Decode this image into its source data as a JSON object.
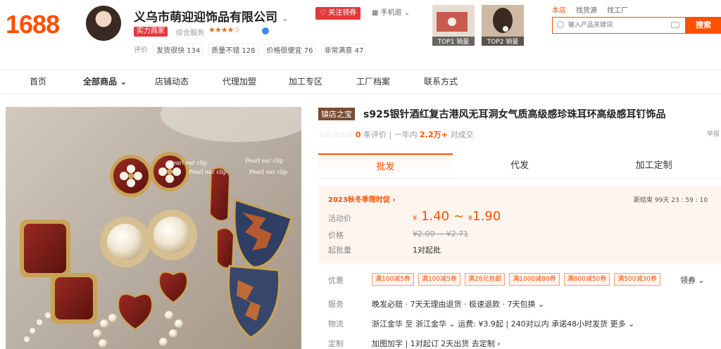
{
  "header": {
    "logo": "1688",
    "shop_name": "义乌市萌迎迎饰品有限公司",
    "badge": "实力商家",
    "service_label": "综合服务",
    "stars": "★★★★☆",
    "ratings_label": "评价",
    "ratings": [
      "发货很快 134",
      "质量不错 128",
      "价格很便宜 76",
      "非常满意 47"
    ],
    "follow_label": "关注领券",
    "mobile_label": "手机逛",
    "top1_label": "TOP1 销量",
    "top2_label": "TOP2 销量"
  },
  "search": {
    "tabs": [
      "本店",
      "找货源",
      "找工厂"
    ],
    "placeholder": "输入产品关键词",
    "button": "搜索"
  },
  "nav": {
    "items": [
      "首页",
      "全部商品",
      "店铺动态",
      "代理加盟",
      "加工专区",
      "工厂档案",
      "联系方式"
    ]
  },
  "gallery": {
    "caption1": "Pearl ear clip",
    "caption2": "Pearl ear clip",
    "caption3": "Pearl ear clip",
    "caption4": "Pearl ear clip"
  },
  "product": {
    "tag": "镇店之宝",
    "title": "s925银针酒红复古港风无耳洞女气质高级感珍珠耳环高级感耳钉饰品",
    "reviews_count": "0",
    "reviews_label": "条评价",
    "sales_period": "一年内",
    "sales_value": "2.2万+",
    "sales_label": "对成交",
    "cut_label": "举报"
  },
  "tabs": [
    "批发",
    "代发",
    "加工定制"
  ],
  "pricing": {
    "promo": "2023秋冬季限时促 ›",
    "countdown_label": "距结束",
    "countdown": "99天 23 : 59 : 10",
    "activity_label": "活动价",
    "activity_low": "1.40",
    "activity_high": "1.90",
    "currency": "¥",
    "tilde": "~",
    "price_label": "价格",
    "orig_price": "¥2.00 ~ ¥2.71",
    "moq_label": "起批量",
    "moq": "1对起批"
  },
  "rows": {
    "coupon_label": "优惠",
    "coupons": [
      "满100减5券",
      "满100减5券",
      "满28元包邮",
      "满1000减80券",
      "满800减50券",
      "满500减30券"
    ],
    "coupon_more": "领券 ⌄",
    "service_label": "服务",
    "service": "晚发必赔 · 7天无理由退货 · 极速退款 · 7天包换 ⌄",
    "logistics_label": "物流",
    "logistics": "浙江金华 至 浙江金华 ⌄  运费: ¥3.9起  |  240对以内 承诺48小时发货  更多 ⌄",
    "custom_label": "定制",
    "custom": "加图加字  |  1对起订 2天出货    去定制 ›"
  }
}
